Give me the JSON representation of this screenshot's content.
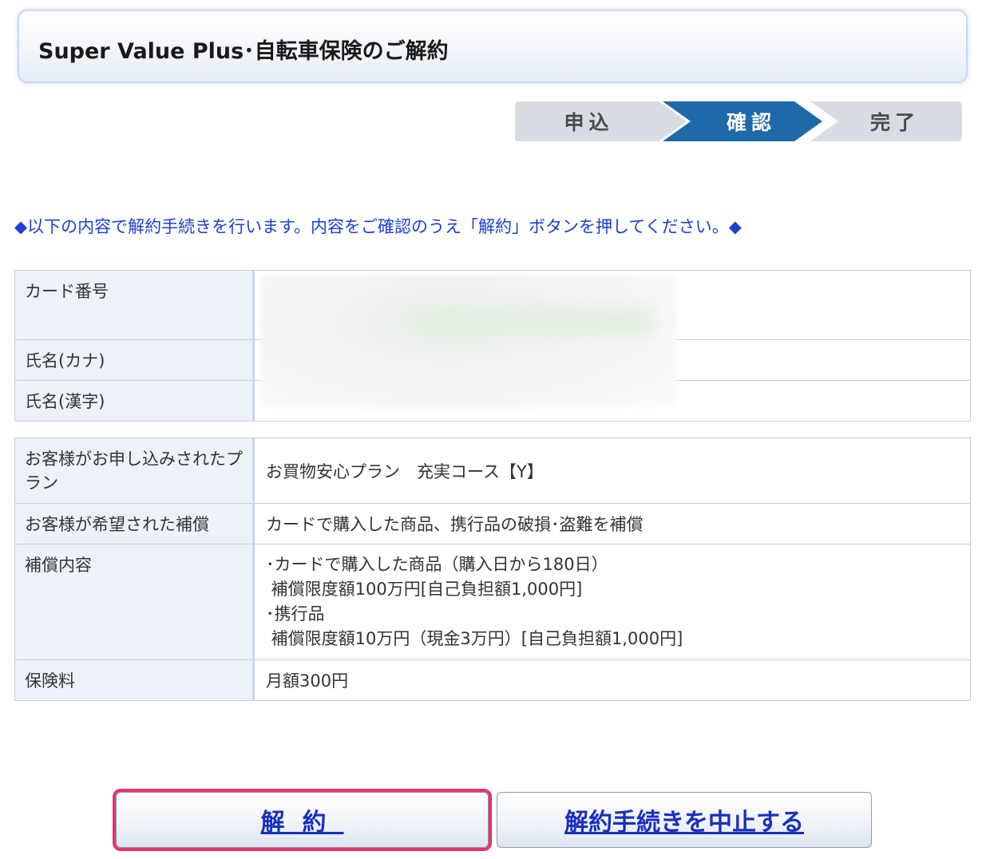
{
  "header": {
    "title": "Super Value Plus･自転車保険のご解約"
  },
  "steps": [
    "申込",
    "確認",
    "完了"
  ],
  "current_step": "確認",
  "notice": "◆以下の内容で解約手続きを行います。内容をご確認のうえ「解約」ボタンを押してください。◆",
  "customer_table": {
    "rows": [
      {
        "label": "カード番号",
        "value": ""
      },
      {
        "label": "氏名(カナ)",
        "value": ""
      },
      {
        "label": "氏名(漢字)",
        "value": ""
      }
    ]
  },
  "plan_table": {
    "rows": [
      {
        "label": "お客様がお申し込みされたプラン",
        "value": "お買物安心プラン　充実コース【Y】"
      },
      {
        "label": "お客様が希望された補償",
        "value": "カードで購入した商品、携行品の破損･盗難を補償"
      },
      {
        "label": "補償内容",
        "lines": [
          "･カードで購入した商品（購入日から180日）",
          " 補償限度額100万円[自己負担額1,000円]",
          "･携行品",
          " 補償限度額10万円（現金3万円）[自己負担額1,000円]"
        ]
      },
      {
        "label": "保険料",
        "value": "月額300円"
      }
    ]
  },
  "buttons": {
    "cancel_contract": "解約",
    "abort": "解約手続きを中止する"
  },
  "colors": {
    "active_step": "#1e6aa9",
    "notice_text": "#1d3fd0",
    "highlight_outline": "#e6336b"
  }
}
